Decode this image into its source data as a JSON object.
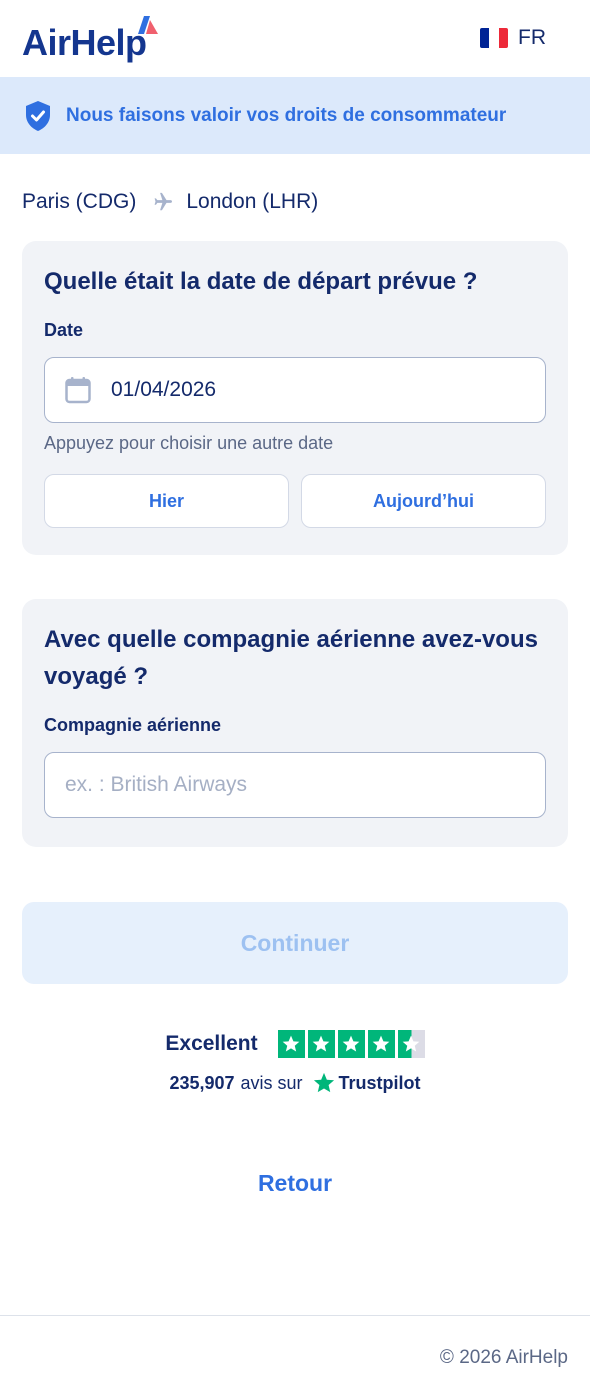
{
  "header": {
    "logo_text": "AirHelp",
    "language_code": "FR",
    "flag_colors": [
      "#002395",
      "#ffffff",
      "#ed2939"
    ]
  },
  "banner": {
    "icon": "shield-check-icon",
    "text": "Nous faisons valoir vos droits de consommateur"
  },
  "route": {
    "origin": "Paris (CDG)",
    "destination": "London (LHR)",
    "icon": "plane-icon"
  },
  "date_card": {
    "title": "Quelle était la date de départ prévue ?",
    "field_label": "Date",
    "value": "01/04/2026",
    "icon": "calendar-icon",
    "hint": "Appuyez pour choisir une autre date",
    "quick_buttons": [
      "Hier",
      "Aujourd’hui"
    ]
  },
  "airline_card": {
    "title": "Avec quelle compagnie aérienne avez-vous voyagé ?",
    "field_label": "Compagnie aérienne",
    "placeholder": "ex. : British Airways"
  },
  "continue_label": "Continuer",
  "trustpilot": {
    "rating_label": "Excellent",
    "stars": 4.5,
    "review_count": "235,907",
    "reviews_text": "avis sur",
    "brand": "Trustpilot",
    "brand_color": "#00b67a"
  },
  "back_label": "Retour",
  "footer": {
    "copyright": "© 2026 AirHelp"
  },
  "colors": {
    "primary": "#2f6fe0",
    "navy": "#142a6b",
    "banner_bg": "#dce9fb"
  }
}
